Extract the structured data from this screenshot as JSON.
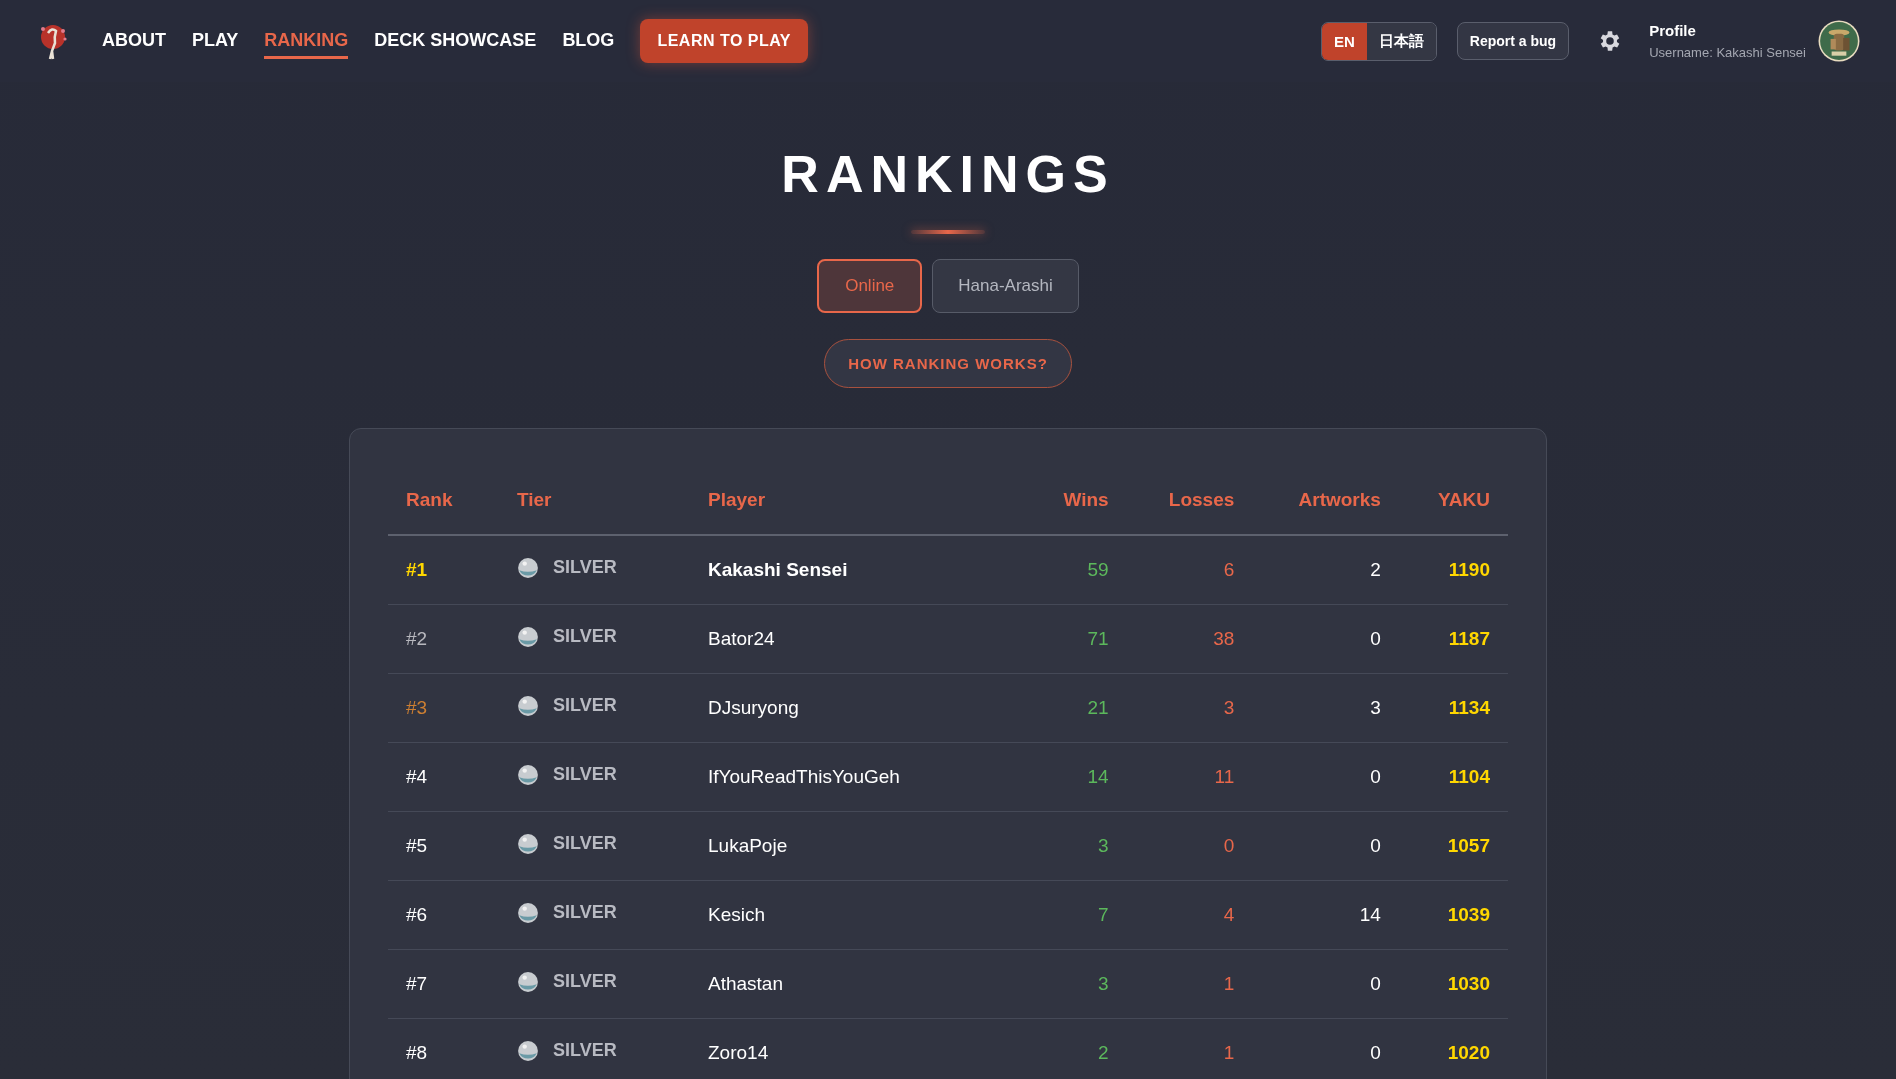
{
  "nav": {
    "items": [
      {
        "label": "ABOUT",
        "selected": false
      },
      {
        "label": "PLAY",
        "selected": false
      },
      {
        "label": "RANKING",
        "selected": true
      },
      {
        "label": "DECK SHOWCASE",
        "selected": false
      },
      {
        "label": "BLOG",
        "selected": false
      }
    ],
    "cta": "LEARN TO PLAY",
    "languages": [
      {
        "label": "EN",
        "selected": true
      },
      {
        "label": "日本語",
        "selected": false
      }
    ],
    "report_bug": "Report a bug",
    "profile": {
      "title": "Profile",
      "username": "Username: Kakashi Sensei"
    }
  },
  "page_title": "RANKINGS",
  "mode_tabs": [
    {
      "label": "Online",
      "selected": true
    },
    {
      "label": "Hana-Arashi",
      "selected": false
    }
  ],
  "how_button": "HOW RANKING WORKS?",
  "table": {
    "columns": [
      "Rank",
      "Tier",
      "Player",
      "Wins",
      "Losses",
      "Artworks",
      "YAKU"
    ],
    "rows": [
      {
        "rank": "#1",
        "color": "#ffd700",
        "tier": "SILVER",
        "player": "Kakashi Sensei",
        "highlighted": true,
        "wins": "59",
        "losses": "6",
        "artworks": "2",
        "yaku": "1190"
      },
      {
        "rank": "#2",
        "color": "#b8b8be",
        "tier": "SILVER",
        "player": "Bator24",
        "highlighted": false,
        "wins": "71",
        "losses": "38",
        "artworks": "0",
        "yaku": "1187"
      },
      {
        "rank": "#3",
        "color": "#cd7f32",
        "tier": "SILVER",
        "player": "DJsuryong",
        "highlighted": false,
        "wins": "21",
        "losses": "3",
        "artworks": "3",
        "yaku": "1134"
      },
      {
        "rank": "#4",
        "color": "#ffffff",
        "tier": "SILVER",
        "player": "IfYouReadThisYouGeh",
        "highlighted": false,
        "wins": "14",
        "losses": "11",
        "artworks": "0",
        "yaku": "1104"
      },
      {
        "rank": "#5",
        "color": "#ffffff",
        "tier": "SILVER",
        "player": "LukaPoje",
        "highlighted": false,
        "wins": "3",
        "losses": "0",
        "artworks": "0",
        "yaku": "1057"
      },
      {
        "rank": "#6",
        "color": "#ffffff",
        "tier": "SILVER",
        "player": "Kesich",
        "highlighted": false,
        "wins": "7",
        "losses": "4",
        "artworks": "14",
        "yaku": "1039"
      },
      {
        "rank": "#7",
        "color": "#ffffff",
        "tier": "SILVER",
        "player": "Athastan",
        "highlighted": false,
        "wins": "3",
        "losses": "1",
        "artworks": "0",
        "yaku": "1030"
      },
      {
        "rank": "#8",
        "color": "#ffffff",
        "tier": "SILVER",
        "player": "Zoro14",
        "highlighted": false,
        "wins": "2",
        "losses": "1",
        "artworks": "0",
        "yaku": "1020"
      }
    ]
  }
}
